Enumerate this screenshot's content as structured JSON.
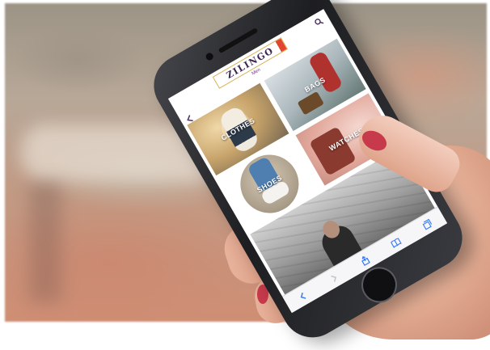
{
  "app": {
    "logo_text": "ZILINGO",
    "subtitle": "Men"
  },
  "categories": [
    {
      "label": "CLOTHES",
      "image": "clothes-photo"
    },
    {
      "label": "BAGS",
      "image": "bags-photo"
    },
    {
      "label": "SHOES",
      "image": "shoes-photo"
    },
    {
      "label": "WATCHES",
      "image": "watches-photo"
    }
  ],
  "banner": {
    "image": "man-graffiti-photo"
  },
  "icons": {
    "search": "search-icon",
    "back": "chevron-left-icon",
    "toolbar": [
      "back-icon",
      "forward-icon",
      "share-icon",
      "bookmarks-icon",
      "tabs-icon"
    ]
  },
  "colors": {
    "brand_text": "#3e2450",
    "brand_border": "#d7b25a",
    "accent": "#7a3b8c",
    "nail_polish": "#c73a4c"
  }
}
